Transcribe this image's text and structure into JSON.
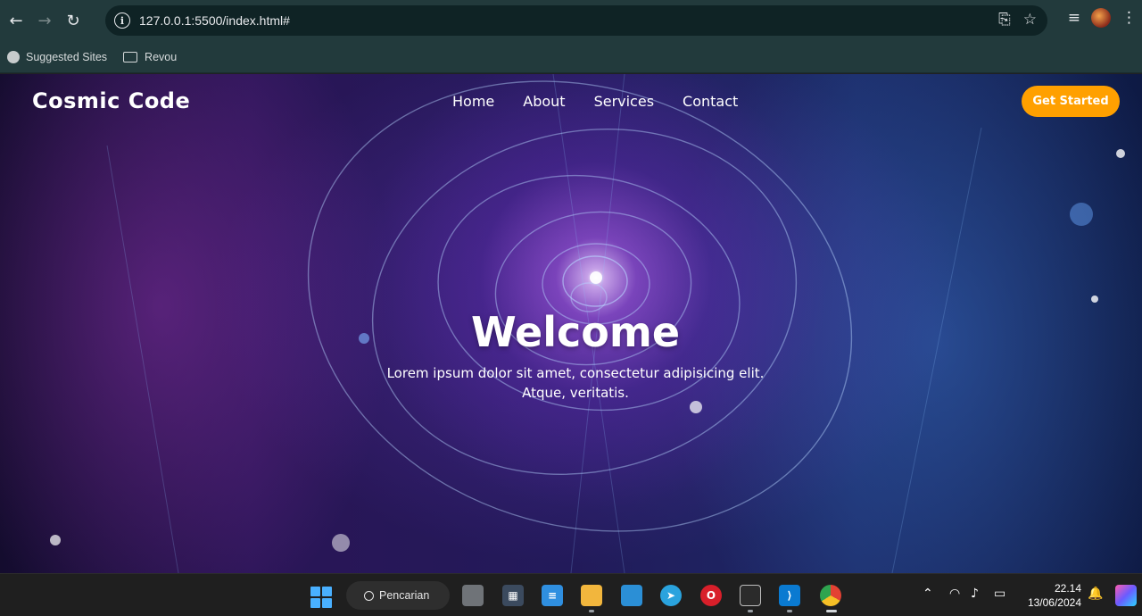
{
  "browser": {
    "url": "127.0.0.1:5500/index.html#",
    "bookmarks": [
      "Suggested Sites",
      "Revou"
    ]
  },
  "site": {
    "logo": "Cosmic Code",
    "menu": [
      "Home",
      "About",
      "Services",
      "Contact"
    ],
    "cta": "Get Started",
    "hero_title": "Welcome",
    "hero_line1": "Lorem ipsum dolor sit amet, consectetur adipisicing elit.",
    "hero_line2": "Atque, veritatis.",
    "cta_color": "#ffa000"
  },
  "taskbar": {
    "search_label": "Pencarian",
    "time": "22.14",
    "date": "13/06/2024"
  }
}
